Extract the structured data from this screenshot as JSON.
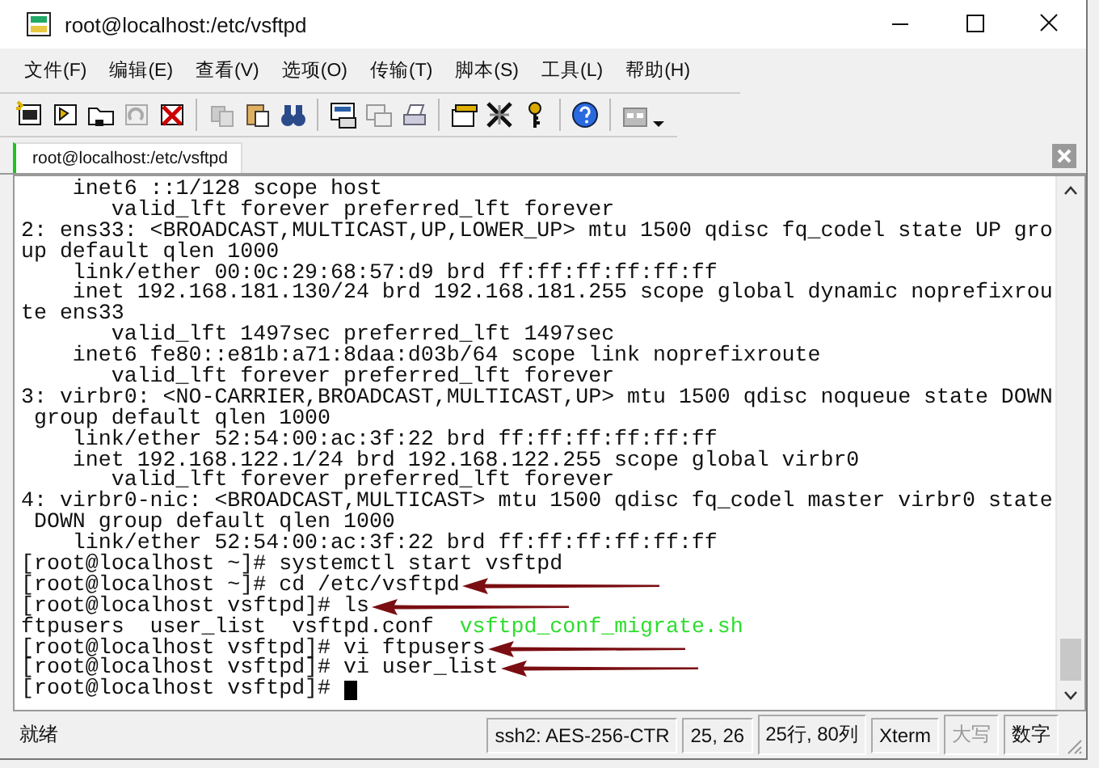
{
  "window": {
    "title": "root@localhost:/etc/vsftpd"
  },
  "menu": [
    "文件(F)",
    "编辑(E)",
    "查看(V)",
    "选项(O)",
    "传输(T)",
    "脚本(S)",
    "工具(L)",
    "帮助(H)"
  ],
  "tabs": [
    {
      "label": "root@localhost:/etc/vsftpd",
      "selected": true
    }
  ],
  "terminal": {
    "lines": [
      {
        "segments": [
          {
            "text": "    inet6 ::1/128 scope host",
            "kind": "plain"
          }
        ],
        "arrow": false
      },
      {
        "segments": [
          {
            "text": "       valid_lft forever preferred_lft forever",
            "kind": "plain"
          }
        ],
        "arrow": false
      },
      {
        "segments": [
          {
            "text": "2: ens33: <BROADCAST,MULTICAST,UP,LOWER_UP> mtu 1500 qdisc fq_codel state UP gro",
            "kind": "plain"
          }
        ],
        "arrow": false
      },
      {
        "segments": [
          {
            "text": "up default qlen 1000",
            "kind": "plain"
          }
        ],
        "arrow": false
      },
      {
        "segments": [
          {
            "text": "    link/ether 00:0c:29:68:57:d9 brd ff:ff:ff:ff:ff:ff",
            "kind": "plain"
          }
        ],
        "arrow": false
      },
      {
        "segments": [
          {
            "text": "    inet 192.168.181.130/24 brd 192.168.181.255 scope global dynamic noprefixrou",
            "kind": "plain"
          }
        ],
        "arrow": false
      },
      {
        "segments": [
          {
            "text": "te ens33",
            "kind": "plain"
          }
        ],
        "arrow": false
      },
      {
        "segments": [
          {
            "text": "       valid_lft 1497sec preferred_lft 1497sec",
            "kind": "plain"
          }
        ],
        "arrow": false
      },
      {
        "segments": [
          {
            "text": "    inet6 fe80::e81b:a71:8daa:d03b/64 scope link noprefixroute",
            "kind": "plain"
          }
        ],
        "arrow": false
      },
      {
        "segments": [
          {
            "text": "       valid_lft forever preferred_lft forever",
            "kind": "plain"
          }
        ],
        "arrow": false
      },
      {
        "segments": [
          {
            "text": "3: virbr0: <NO-CARRIER,BROADCAST,MULTICAST,UP> mtu 1500 qdisc noqueue state DOWN",
            "kind": "plain"
          }
        ],
        "arrow": false
      },
      {
        "segments": [
          {
            "text": " group default qlen 1000",
            "kind": "plain"
          }
        ],
        "arrow": false
      },
      {
        "segments": [
          {
            "text": "    link/ether 52:54:00:ac:3f:22 brd ff:ff:ff:ff:ff:ff",
            "kind": "plain"
          }
        ],
        "arrow": false
      },
      {
        "segments": [
          {
            "text": "    inet 192.168.122.1/24 brd 192.168.122.255 scope global virbr0",
            "kind": "plain"
          }
        ],
        "arrow": false
      },
      {
        "segments": [
          {
            "text": "       valid_lft forever preferred_lft forever",
            "kind": "plain"
          }
        ],
        "arrow": false
      },
      {
        "segments": [
          {
            "text": "4: virbr0-nic: <BROADCAST,MULTICAST> mtu 1500 qdisc fq_codel master virbr0 state",
            "kind": "plain"
          }
        ],
        "arrow": false
      },
      {
        "segments": [
          {
            "text": " DOWN group default qlen 1000",
            "kind": "plain"
          }
        ],
        "arrow": false
      },
      {
        "segments": [
          {
            "text": "    link/ether 52:54:00:ac:3f:22 brd ff:ff:ff:ff:ff:ff",
            "kind": "plain"
          }
        ],
        "arrow": false
      },
      {
        "segments": [
          {
            "text": "[root@localhost ~]# systemctl start vsftpd",
            "kind": "plain"
          }
        ],
        "arrow": false
      },
      {
        "segments": [
          {
            "text": "[root@localhost ~]# cd /etc/vsftpd",
            "kind": "plain"
          }
        ],
        "arrow": true
      },
      {
        "segments": [
          {
            "text": "[root@localhost vsftpd]# ls",
            "kind": "plain"
          }
        ],
        "arrow": true
      },
      {
        "segments": [
          {
            "text": "ftpusers  user_list  vsftpd.conf  ",
            "kind": "plain"
          },
          {
            "text": "vsftpd_conf_migrate.sh",
            "kind": "executable"
          }
        ],
        "arrow": false
      },
      {
        "segments": [
          {
            "text": "[root@localhost vsftpd]# vi ftpusers",
            "kind": "plain"
          }
        ],
        "arrow": true
      },
      {
        "segments": [
          {
            "text": "[root@localhost vsftpd]# vi user_list",
            "kind": "plain"
          }
        ],
        "arrow": true
      },
      {
        "segments": [
          {
            "text": "[root@localhost vsftpd]# ",
            "kind": "plain"
          }
        ],
        "arrow": false,
        "cursor": true
      }
    ]
  },
  "status_bar": [
    {
      "text": "就绪",
      "disabled": false
    },
    {
      "text": "ssh2: AES-256-CTR",
      "disabled": false
    },
    {
      "text": "25,  26",
      "disabled": false
    },
    {
      "text": "25行, 80列",
      "disabled": false
    },
    {
      "text": "Xterm",
      "disabled": false
    },
    {
      "text": "大写",
      "disabled": true
    },
    {
      "text": "数字",
      "disabled": false
    }
  ]
}
